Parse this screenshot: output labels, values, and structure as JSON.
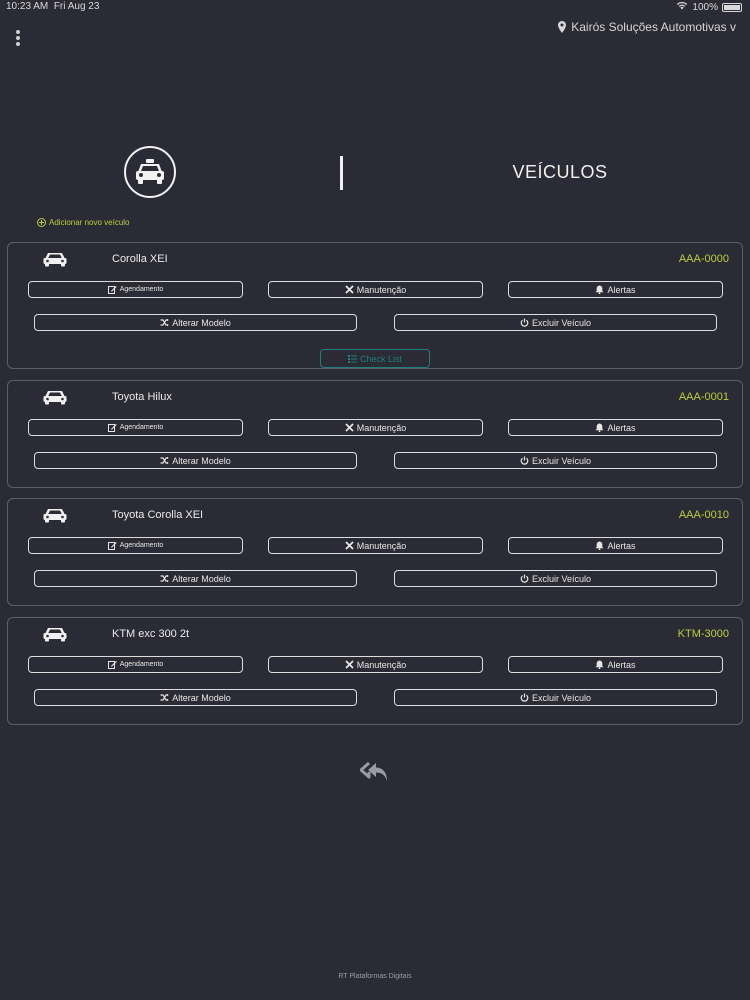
{
  "status_bar": {
    "time": "10:23 AM",
    "date": "Fri Aug 23",
    "battery": "100%"
  },
  "header": {
    "company": "Kairós Soluções Automotivas v"
  },
  "hero": {
    "title": "VEÍCULOS",
    "icon": "taxi-icon"
  },
  "add_vehicle_label": "Adicionar novo veículo",
  "buttons": {
    "agendamento": "Agendamento",
    "manutencao": "Manutenção",
    "alertas": "Alertas",
    "alterar_modelo": "Alterar Modelo",
    "excluir_veiculo": "Excluir Veículo",
    "check_list": "Check List"
  },
  "vehicles": [
    {
      "name": "Corolla XEI",
      "plate": "AAA-0000"
    },
    {
      "name": "Toyota Hilux",
      "plate": "AAA-0001"
    },
    {
      "name": "Toyota Corolla XEI",
      "plate": "AAA-0010"
    },
    {
      "name": "KTM exc 300 2t",
      "plate": "KTM-3000"
    }
  ],
  "footer": "RT Plataformas Digitais",
  "colors": {
    "background": "#2b2b35",
    "accent": "#b9cf3a",
    "checklist": "#1f7f7a",
    "border": "#5d5d67"
  }
}
